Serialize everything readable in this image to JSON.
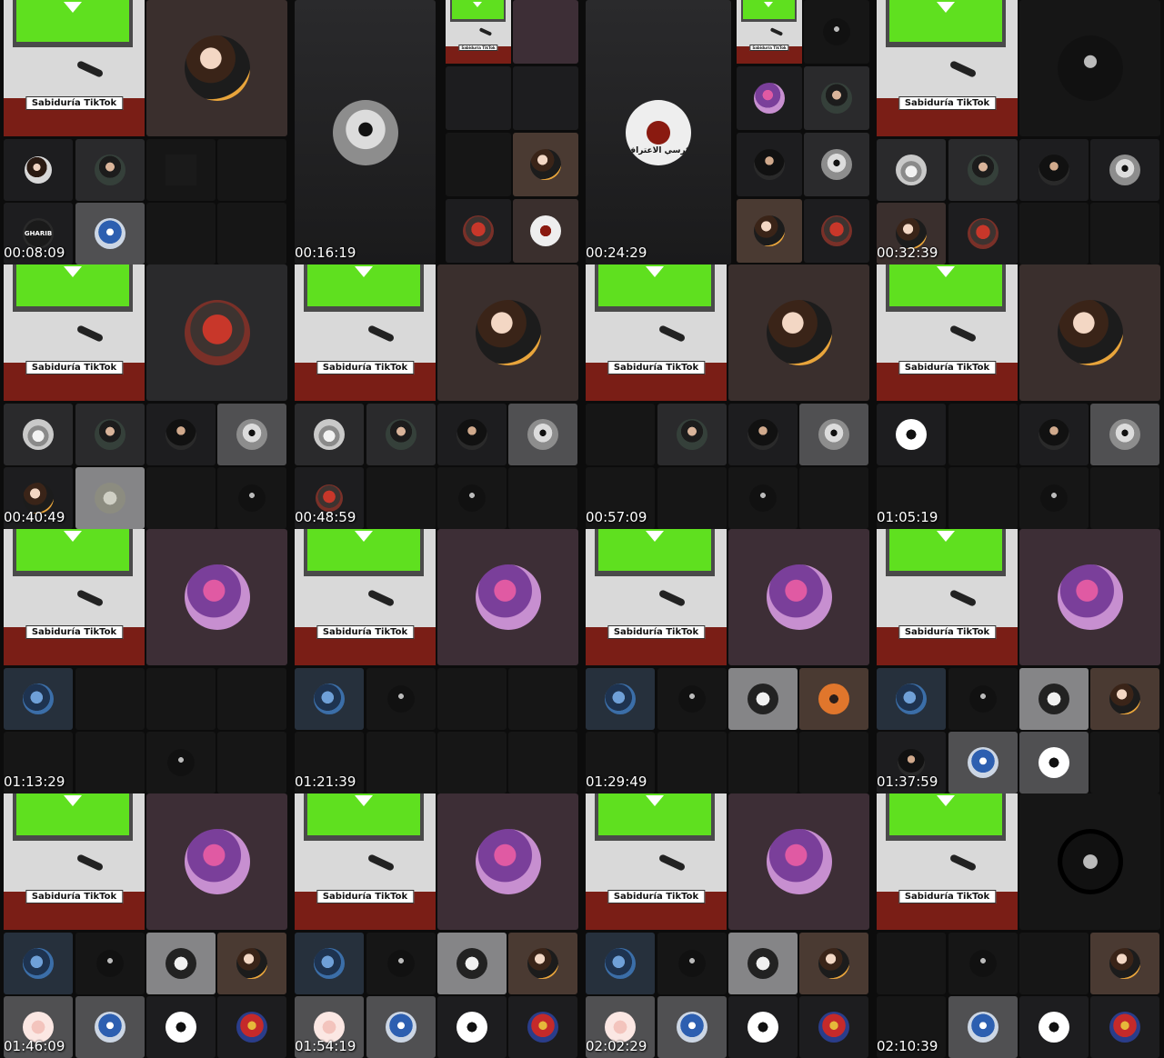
{
  "stage": {
    "label": "Sabiduría TikTok"
  },
  "avatars": {
    "gharib": "GHARIB",
    "arabic_chair": "كرسي الاعتراف"
  },
  "colors": {
    "green_screen": "#5fe01f",
    "podium": "#7a1e16",
    "stage_wall": "#d9d9d9",
    "background": "#000000"
  },
  "frames": [
    {
      "time": "00:08:09"
    },
    {
      "time": "00:16:19"
    },
    {
      "time": "00:24:29"
    },
    {
      "time": "00:32:39"
    },
    {
      "time": "00:40:49"
    },
    {
      "time": "00:48:59"
    },
    {
      "time": "00:57:09"
    },
    {
      "time": "01:05:19"
    },
    {
      "time": "01:13:29"
    },
    {
      "time": "01:21:39"
    },
    {
      "time": "01:29:49"
    },
    {
      "time": "01:37:59"
    },
    {
      "time": "01:46:09"
    },
    {
      "time": "01:54:19"
    },
    {
      "time": "02:02:29"
    },
    {
      "time": "02:10:39"
    }
  ]
}
